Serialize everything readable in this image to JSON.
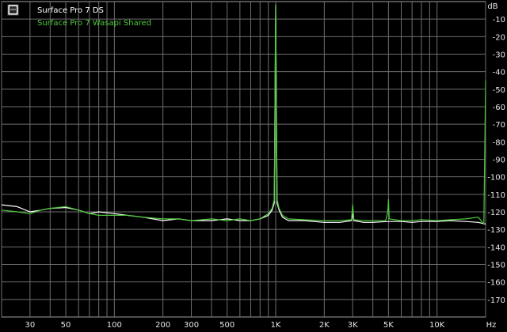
{
  "chart_data": {
    "type": "line",
    "title": "",
    "xlabel": "Hz",
    "ylabel": "dB",
    "x_scale": "log",
    "xlim": [
      20,
      20000
    ],
    "ylim": [
      -180,
      0
    ],
    "grid": true,
    "legend_position": "top-left",
    "x_ticks": [
      30,
      50,
      100,
      200,
      300,
      500,
      1000,
      2000,
      3000,
      5000,
      10000
    ],
    "x_tick_labels": [
      "30",
      "50",
      "100",
      "200",
      "300",
      "500",
      "1K",
      "2K",
      "3K",
      "5K",
      "10K"
    ],
    "y_ticks": [
      -10,
      -20,
      -30,
      -40,
      -50,
      -60,
      -70,
      -80,
      -90,
      -100,
      -110,
      -120,
      -130,
      -140,
      -150,
      -160,
      -170
    ],
    "y_tick_labels": [
      "-10",
      "-20",
      "-30",
      "-40",
      "-50",
      "-60",
      "-70",
      "-80",
      "-90",
      "-100",
      "-110",
      "-120",
      "-130",
      "-140",
      "-150",
      "-160",
      "-170"
    ],
    "series": [
      {
        "name": "Surface Pro 7 DS",
        "color": "#ffffff",
        "x": [
          20,
          25,
          30,
          35,
          40,
          50,
          60,
          70,
          80,
          100,
          120,
          150,
          200,
          250,
          300,
          400,
          500,
          600,
          700,
          800,
          900,
          950,
          980,
          1000,
          1020,
          1050,
          1100,
          1200,
          1500,
          2000,
          2500,
          2950,
          3000,
          3050,
          3500,
          4000,
          5000,
          6000,
          7000,
          8000,
          10000,
          12000,
          15000,
          18000,
          20000
        ],
        "y": [
          -116,
          -117,
          -120,
          -119,
          -118,
          -117.5,
          -119,
          -121,
          -120,
          -121,
          -122,
          -123,
          -125,
          -124,
          -125,
          -125,
          -124,
          -125,
          -125,
          -124,
          -122,
          -119,
          -115,
          -2,
          -115,
          -119,
          -123,
          -125,
          -125,
          -126,
          -126,
          -125,
          -121,
          -125,
          -126,
          -126,
          -125.5,
          -125.5,
          -126,
          -125.5,
          -125.5,
          -125,
          -125.5,
          -126,
          -127
        ]
      },
      {
        "name": "Surface Pro 7 Wasapi Shared",
        "color": "#4cc93a",
        "x": [
          20,
          25,
          30,
          35,
          40,
          50,
          60,
          70,
          80,
          100,
          120,
          150,
          200,
          250,
          300,
          400,
          500,
          600,
          700,
          800,
          900,
          950,
          980,
          1000,
          1020,
          1050,
          1100,
          1200,
          1500,
          2000,
          2500,
          2950,
          3000,
          3050,
          3500,
          4000,
          4800,
          4950,
          5000,
          5050,
          6000,
          7000,
          8000,
          10000,
          12000,
          15000,
          18000,
          19500,
          20000
        ],
        "y": [
          -119,
          -120,
          -121,
          -119,
          -118,
          -117,
          -119,
          -121,
          -122,
          -122,
          -122,
          -123,
          -124,
          -124,
          -125,
          -124,
          -125,
          -124,
          -125,
          -124,
          -121,
          -118,
          -113,
          -2,
          -113,
          -118,
          -122,
          -124,
          -124.5,
          -125,
          -125,
          -124.5,
          -116,
          -124.5,
          -125,
          -125,
          -125,
          -120,
          -113,
          -124,
          -125,
          -125,
          -124.5,
          -125,
          -124.5,
          -124,
          -123,
          -127,
          -45
        ]
      }
    ]
  }
}
